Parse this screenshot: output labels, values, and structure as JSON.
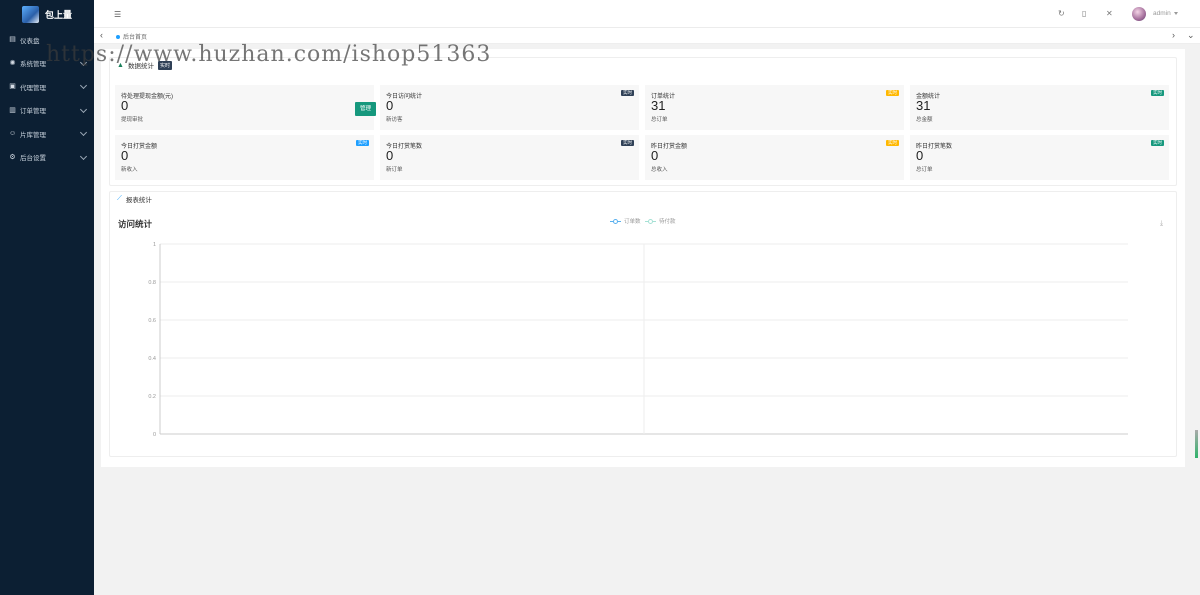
{
  "brand": {
    "name": "包上量"
  },
  "sidebar": {
    "items": [
      {
        "label": "仪表盘",
        "icon": "dashboard-icon",
        "has_children": false
      },
      {
        "label": "系统管理",
        "icon": "gear-icon",
        "has_children": true
      },
      {
        "label": "代理管理",
        "icon": "agent-icon",
        "has_children": true
      },
      {
        "label": "订单管理",
        "icon": "order-icon",
        "has_children": true
      },
      {
        "label": "片库管理",
        "icon": "library-icon",
        "has_children": true
      },
      {
        "label": "后台设置",
        "icon": "settings-icon",
        "has_children": true
      }
    ]
  },
  "header": {
    "user": "admin",
    "icons": [
      "hamburger-icon",
      "refresh-icon",
      "clear-icon",
      "fullscreen-icon"
    ]
  },
  "tabs": {
    "home_label": "后台首页"
  },
  "watermark": "https://www.huzhan.com/ishop51363",
  "stats_panel": {
    "title": "数据统计",
    "badge": "实时",
    "cards": [
      {
        "title": "待处理提现金额(元)",
        "value": "0",
        "sub": "提现审批",
        "button": "管理"
      },
      {
        "title": "今日访问统计",
        "value": "0",
        "sub": "新访客",
        "tag": "实时",
        "tag_color": "#2f4056"
      },
      {
        "title": "订单统计",
        "value": "31",
        "sub": "总订单",
        "tag": "实时",
        "tag_color": "#ffb800"
      },
      {
        "title": "金额统计",
        "value": "31",
        "sub": "总金额",
        "tag": "实时",
        "tag_color": "#16987d"
      },
      {
        "title": "今日打赏金额",
        "value": "0",
        "sub": "新收入",
        "tag": "实时",
        "tag_color": "#1e9fff"
      },
      {
        "title": "今日打赏笔数",
        "value": "0",
        "sub": "新订单",
        "tag": "实时",
        "tag_color": "#2f4056"
      },
      {
        "title": "昨日打赏金额",
        "value": "0",
        "sub": "总收入",
        "tag": "实时",
        "tag_color": "#ffb800"
      },
      {
        "title": "昨日打赏笔数",
        "value": "0",
        "sub": "总订单",
        "tag": "实时",
        "tag_color": "#16987d"
      }
    ]
  },
  "report_panel": {
    "title": "报表统计",
    "chart_title": "访问统计",
    "legend": [
      "订单数",
      "待付款"
    ]
  },
  "chart_data": {
    "type": "line",
    "title": "访问统计",
    "series": [
      {
        "name": "订单数",
        "values": [],
        "color": "#5ab1ef"
      },
      {
        "name": "待付款",
        "values": [],
        "color": "#a6e1d5"
      }
    ],
    "yticks": [
      "1",
      "0.8",
      "0.6",
      "0.4",
      "0.2",
      "0"
    ],
    "ylim": [
      0,
      1
    ],
    "grid": true,
    "legend_position": "top-center"
  },
  "colors": {
    "sidebar": "#0c1f33",
    "accent": "#16987d",
    "primary": "#1e9fff"
  }
}
